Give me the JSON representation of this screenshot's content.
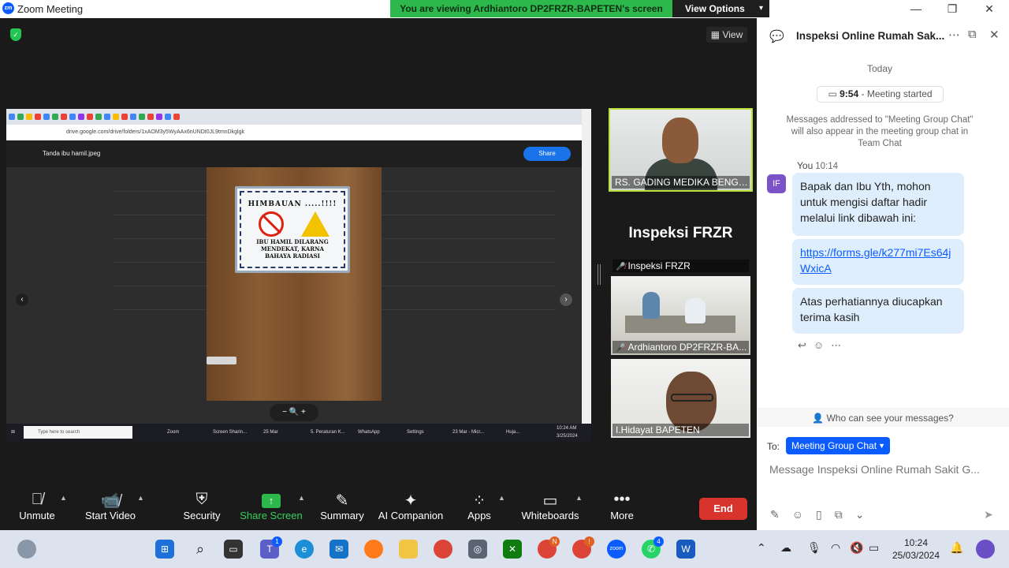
{
  "window": {
    "app_title": "Zoom Meeting",
    "logo_text": "zm",
    "share_banner": "You are viewing Ardhiantoro DP2FRZR-BAPETEN's screen",
    "view_options": "View Options",
    "controls": [
      "—",
      "❐",
      "✕"
    ]
  },
  "meeting": {
    "view_label": "View",
    "shared_screen": {
      "address": "drive.google.com/drive/folders/1xAOM3y5WyAAx6nUNDt0JL9tmnDkglgk",
      "file_name": "Tanda ibu hamil.jpeg",
      "share_label": "Share",
      "sign_title": "HIMBAUAN .....!!!!",
      "sign_lines": [
        "IBU HAMIL DILARANG",
        "MENDEKAT, KARNA",
        "BAHAYA RADIASI"
      ],
      "zoom_controls": "−  🔍  +",
      "taskbar": {
        "search_placeholder": "Type here to search",
        "items": [
          "Zoom",
          "Screen Sharin...",
          "25 Mar",
          "5. Peraturan K...",
          "WhatsApp",
          "Settings",
          "23 Mar - Micr...",
          "Huja..."
        ],
        "time": "10:24 AM",
        "date": "3/25/2024"
      }
    },
    "participants": [
      {
        "name": "RS. GADING MEDIKA BENGK...",
        "muted": false,
        "active_speaker": true
      },
      {
        "name": "Inspeksi FRZR",
        "display_text": "Inspeksi FRZR",
        "muted": true
      },
      {
        "name": "Ardhiantoro DP2FRZR-BA...",
        "muted": true
      },
      {
        "name": "I.Hidayat BAPETEN",
        "muted": false
      }
    ]
  },
  "toolbar": {
    "unmute": "Unmute",
    "start_video": "Start Video",
    "security": "Security",
    "share_screen": "Share Screen",
    "summary": "Summary",
    "ai_companion": "AI Companion",
    "apps": "Apps",
    "whiteboards": "Whiteboards",
    "more": "More",
    "end": "End"
  },
  "chat": {
    "title": "Inspeksi Online Rumah Sak...",
    "today": "Today",
    "meeting_started_time": "9:54",
    "meeting_started_text": "- Meeting started",
    "notice": "Messages addressed to \"Meeting Group Chat\" will also appear in the meeting group chat in Team Chat",
    "sender": "You",
    "sender_initials": "IF",
    "sent_time": "10:14",
    "messages": [
      "Bapak dan Ibu Yth, mohon untuk mengisi daftar hadir melalui link dibawah ini:",
      "https://forms.gle/k277mi7Es64jWxicA",
      "Atas perhatiannya diucapkan terima kasih"
    ],
    "who_can_see": "Who can see your messages?",
    "to_label": "To:",
    "recipient": "Meeting Group Chat",
    "input_placeholder": "Message Inspeksi Online Rumah Sakit G..."
  },
  "taskbar": {
    "time": "10:24",
    "date": "25/03/2024",
    "badges": {
      "teams": "1",
      "chrome_a": "N",
      "chrome_b": "!",
      "whatsapp": "4"
    }
  },
  "colors": {
    "zoom_blue": "#0b5cff",
    "share_green": "#2db84c",
    "end_red": "#d9342b",
    "speaker_border": "#b9e33b",
    "chat_bubble": "#dfeefc"
  }
}
